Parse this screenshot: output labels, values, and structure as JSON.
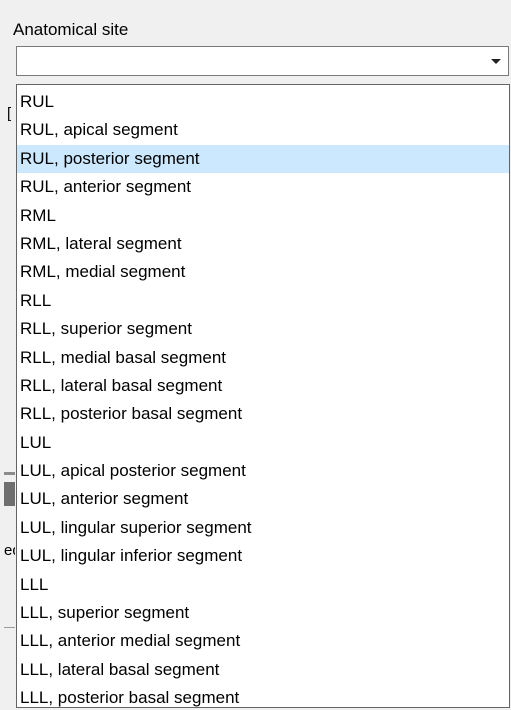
{
  "field": {
    "label": "Anatomical site",
    "value": ""
  },
  "background_fragments": [
    "[",
    "ed"
  ],
  "dropdown": {
    "highlighted_index": 2,
    "options": [
      "RUL",
      "RUL, apical segment",
      "RUL, posterior segment",
      "RUL, anterior segment",
      "RML",
      "RML, lateral segment",
      "RML, medial segment",
      "RLL",
      "RLL, superior segment",
      "RLL, medial basal segment",
      "RLL, lateral basal segment",
      "RLL, posterior basal segment",
      "LUL",
      "LUL, apical posterior segment",
      "LUL, anterior segment",
      "LUL, lingular superior segment",
      "LUL, lingular inferior segment",
      "LLL",
      "LLL, superior segment",
      "LLL, anterior medial segment",
      "LLL, lateral basal segment",
      "LLL, posterior basal segment"
    ]
  },
  "icons": {
    "combo_arrow": "chevron-down-icon"
  },
  "colors": {
    "window_bg": "#f0f0f0",
    "highlight": "#cce8ff",
    "border": "#646464"
  }
}
